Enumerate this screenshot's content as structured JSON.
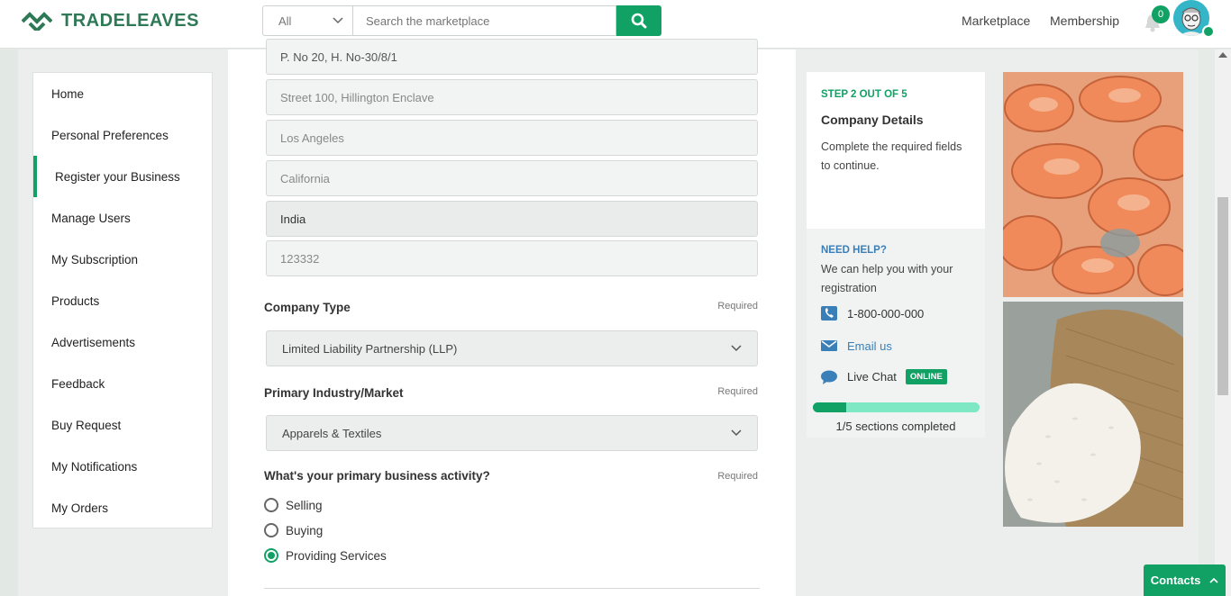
{
  "header": {
    "brand": "TRADELEAVES",
    "search_category": "All",
    "search_placeholder": "Search the marketplace",
    "nav": [
      "Marketplace",
      "Membership"
    ],
    "notification_count": "0"
  },
  "sidebar": {
    "items": [
      {
        "label": "Home"
      },
      {
        "label": "Personal Preferences"
      },
      {
        "label": "Register your Business",
        "active": true
      },
      {
        "label": "Manage Users"
      },
      {
        "label": "My Subscription"
      },
      {
        "label": "Products"
      },
      {
        "label": "Advertisements"
      },
      {
        "label": "Feedback"
      },
      {
        "label": "Buy Request"
      },
      {
        "label": "My Notifications"
      },
      {
        "label": "My Orders"
      }
    ]
  },
  "form": {
    "address_line1": "P. No 20, H. No-30/8/1",
    "address_line2_placeholder": "Street 100, Hillington Enclave",
    "city_placeholder": "Los Angeles",
    "state_placeholder": "California",
    "country": "India",
    "zip_placeholder": "123332",
    "company_type": {
      "label": "Company Type",
      "required": "Required",
      "value": "Limited Liability Partnership (LLP)"
    },
    "industry": {
      "label": "Primary Industry/Market",
      "required": "Required",
      "value": "Apparels & Textiles"
    },
    "activity": {
      "label": "What's your primary business activity?",
      "required": "Required",
      "options": [
        "Selling",
        "Buying",
        "Providing Services"
      ],
      "selected": "Providing Services"
    }
  },
  "step": {
    "label": "STEP 2 OUT OF 5",
    "title": "Company Details",
    "desc": "Complete the required fields to continue.",
    "help_title": "NEED HELP?",
    "help_desc": "We can help you with your registration",
    "phone": "1-800-000-000",
    "email": "Email us",
    "chat": "Live Chat",
    "chat_status": "ONLINE",
    "progress_fraction": 0.2,
    "progress_text": "1/5 sections completed"
  },
  "colors": {
    "brand": "#12a164",
    "logo_text": "#2f7a56",
    "help": "#3a7fb8",
    "progress_track": "#7de8c3"
  },
  "contacts_button": "Contacts"
}
